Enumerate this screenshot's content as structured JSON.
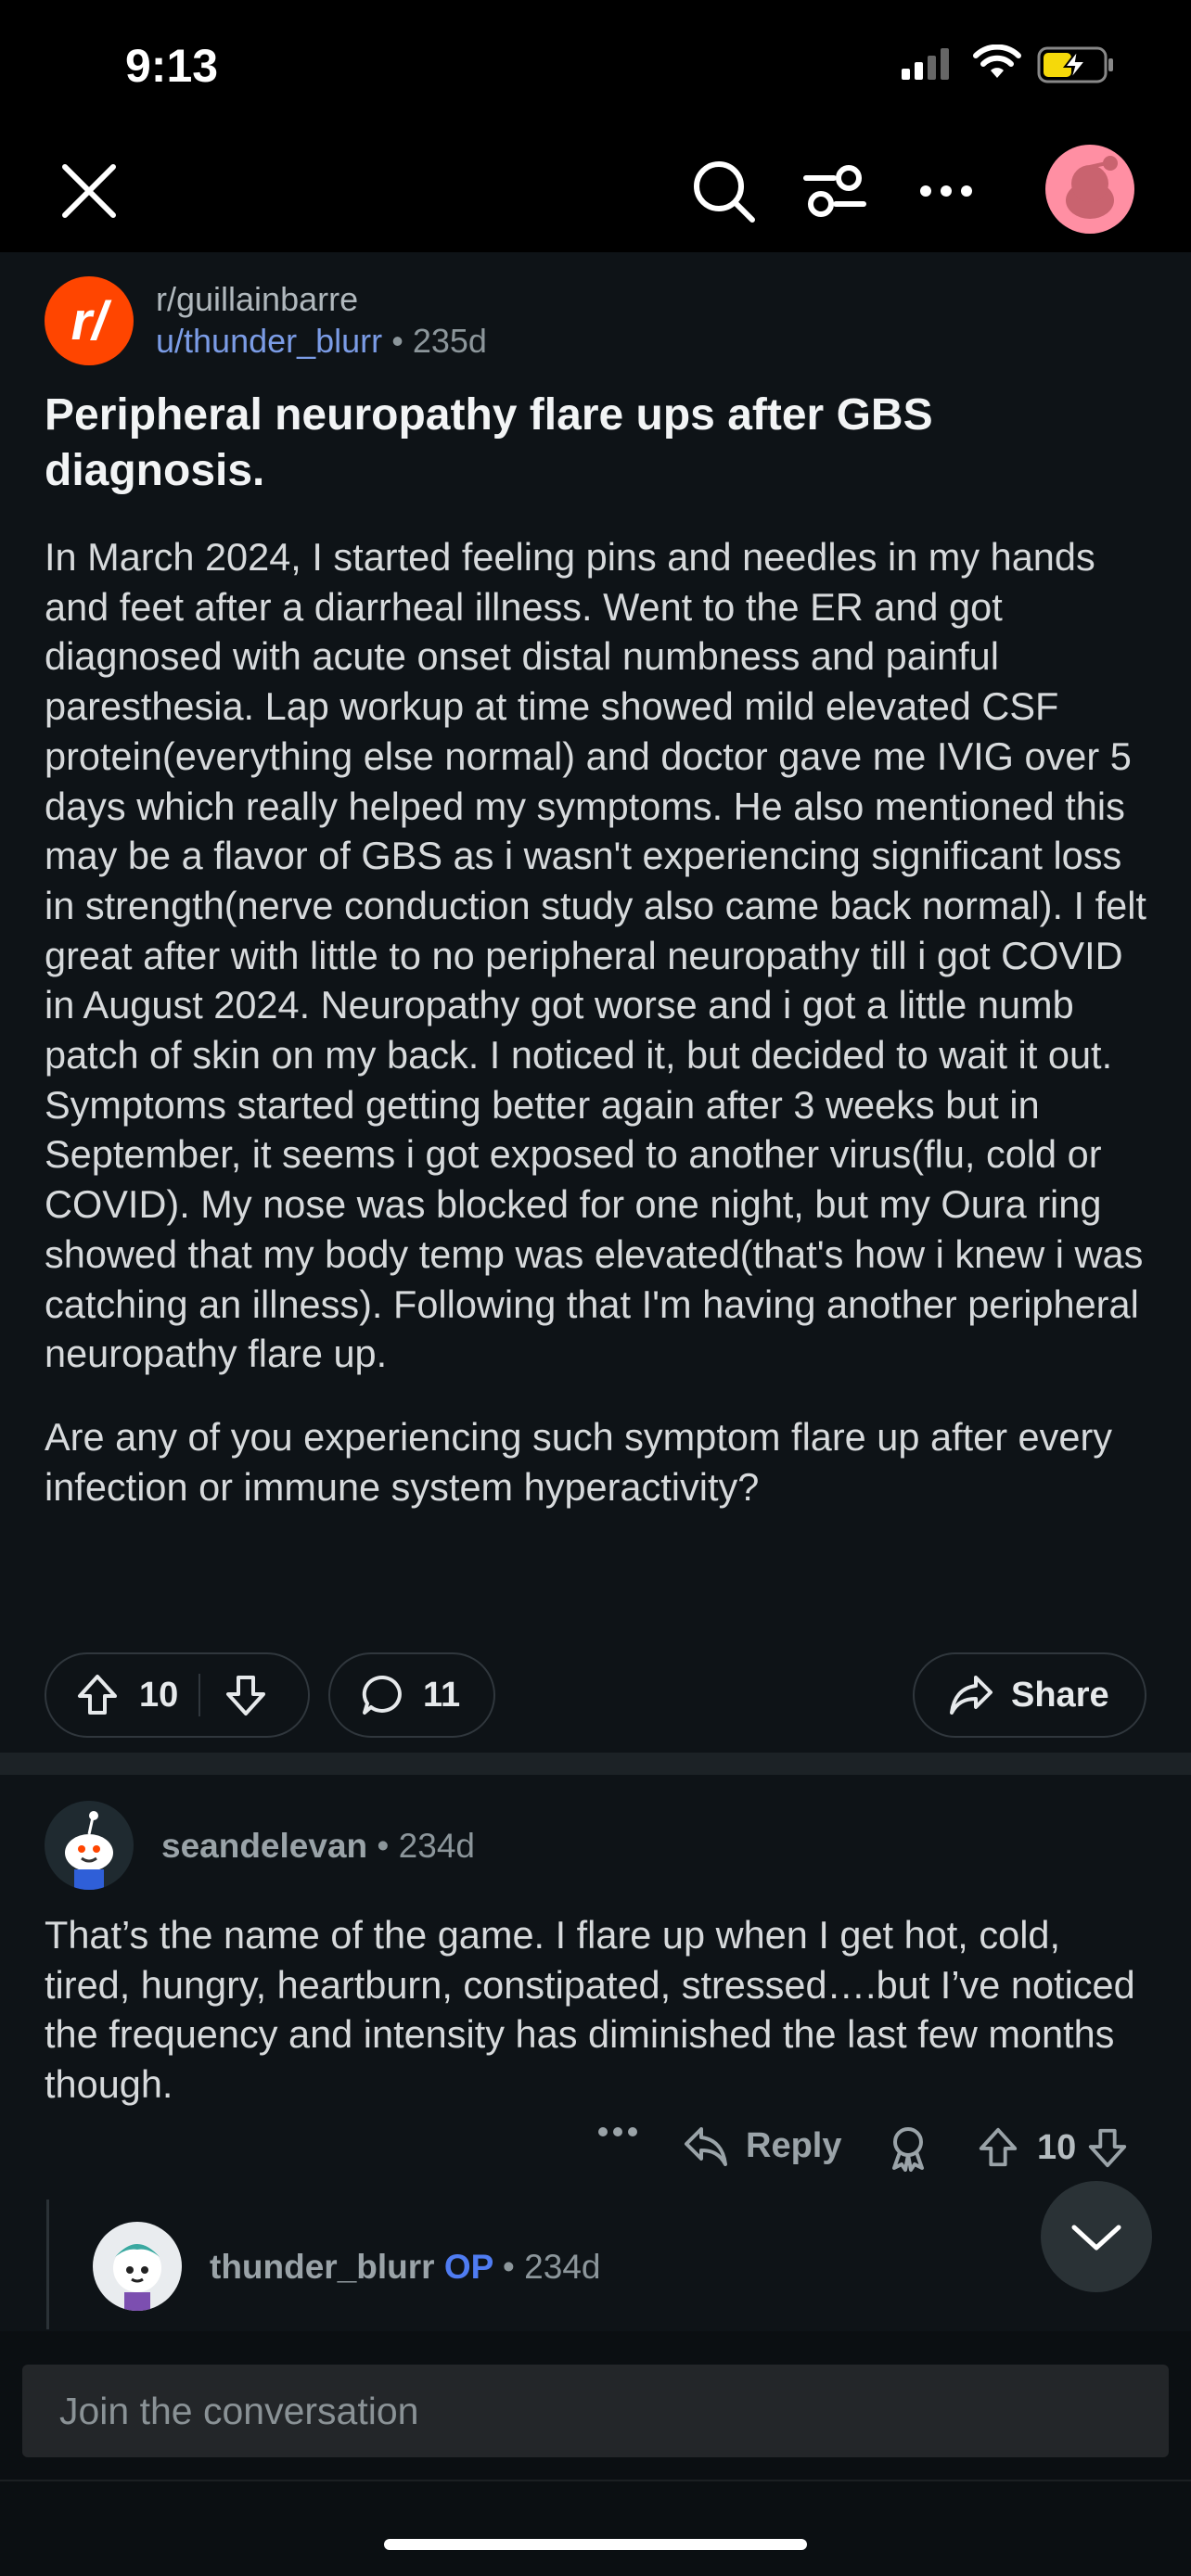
{
  "status_bar": {
    "time": "9:13"
  },
  "post": {
    "subreddit": "r/guillainbarre",
    "author": "u/thunder_blurr",
    "separator": "•",
    "age": "235d",
    "title": "Peripheral neuropathy flare ups after GBS diagnosis.",
    "paragraphs": [
      "In March 2024, I started feeling pins and needles in my hands and feet after a diarrheal illness. Went to the ER and got diagnosed with acute onset distal numbness and painful paresthesia. Lap workup at time showed mild elevated CSF protein(everything else normal) and doctor gave me IVIG over 5 days which really helped my symptoms. He also mentioned this may be a flavor of GBS as i wasn't experiencing significant loss in strength(nerve conduction study also came back normal). I felt great after with little to no peripheral neuropathy till i got COVID in August 2024. Neuropathy got worse and i got a little numb patch of skin on my back. I noticed it, but decided to wait it out. Symptoms started getting better again after 3 weeks but in September, it seems i got exposed to another virus(flu, cold or COVID). My nose was blocked for one night, but my Oura ring showed that my body temp was elevated(that's how i knew i was catching an illness). Following that I'm having another peripheral neuropathy flare up.",
      "Are any of you experiencing such symptom flare up after every infection or immune system hyperactivity?"
    ],
    "votes": "10",
    "comments": "11",
    "share_label": "Share"
  },
  "comment": {
    "author": "seandelevan",
    "separator": "•",
    "age": "234d",
    "body": "That’s the name of the game. I flare up when I get hot, cold, tired, hungry, heartburn, constipated, stressed….but I’ve noticed the frequency and intensity has diminished the last few months though.",
    "reply_label": "Reply",
    "votes": "10"
  },
  "reply": {
    "author": "thunder_blurr",
    "op_badge": "OP",
    "separator": "•",
    "age": "234d"
  },
  "composer": {
    "placeholder": "Join the conversation"
  },
  "colors": {
    "accent": "#ff4500",
    "link": "#7b9ce6",
    "op": "#4f7cf2"
  },
  "icons": [
    "close-icon",
    "search-icon",
    "filter-icon",
    "more-icon",
    "avatar",
    "upvote-icon",
    "downvote-icon",
    "comment-icon",
    "share-icon",
    "reply-icon",
    "award-icon",
    "chevron-down-icon"
  ]
}
